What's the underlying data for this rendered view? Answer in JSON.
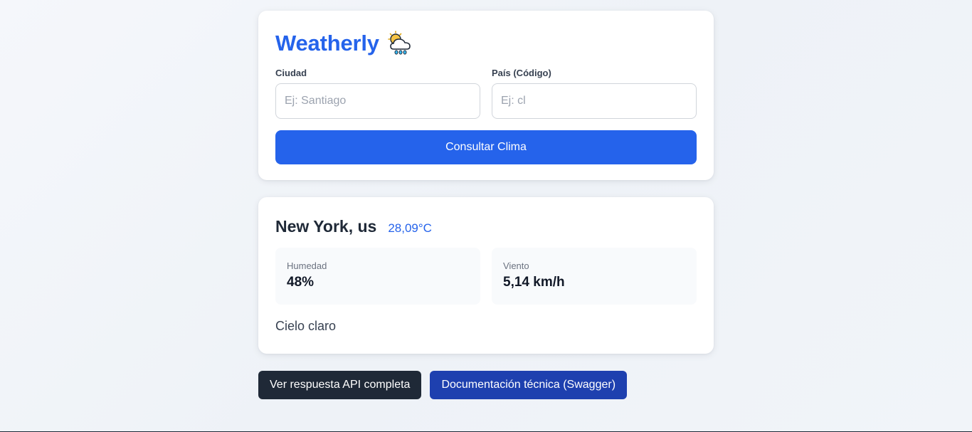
{
  "app": {
    "title": "Weatherly",
    "title_icon": "sun-cloud-rain-icon",
    "accent_color": "#2563eb"
  },
  "search": {
    "city_label": "Ciudad",
    "city_placeholder": "Ej: Santiago",
    "city_value": "",
    "country_label": "País (Código)",
    "country_placeholder": "Ej: cl",
    "country_value": "",
    "submit_label": "Consultar Clima"
  },
  "result": {
    "location": "New York, us",
    "temperature": "28,09°C",
    "humidity_label": "Humedad",
    "humidity_value": "48%",
    "wind_label": "Viento",
    "wind_value": "5,14 km/h",
    "description": "Cielo claro"
  },
  "actions": {
    "api_button": "Ver respuesta API completa",
    "docs_button": "Documentación técnica (Swagger)",
    "api_button_color": "#1f2937",
    "docs_button_color": "#1e40af"
  }
}
